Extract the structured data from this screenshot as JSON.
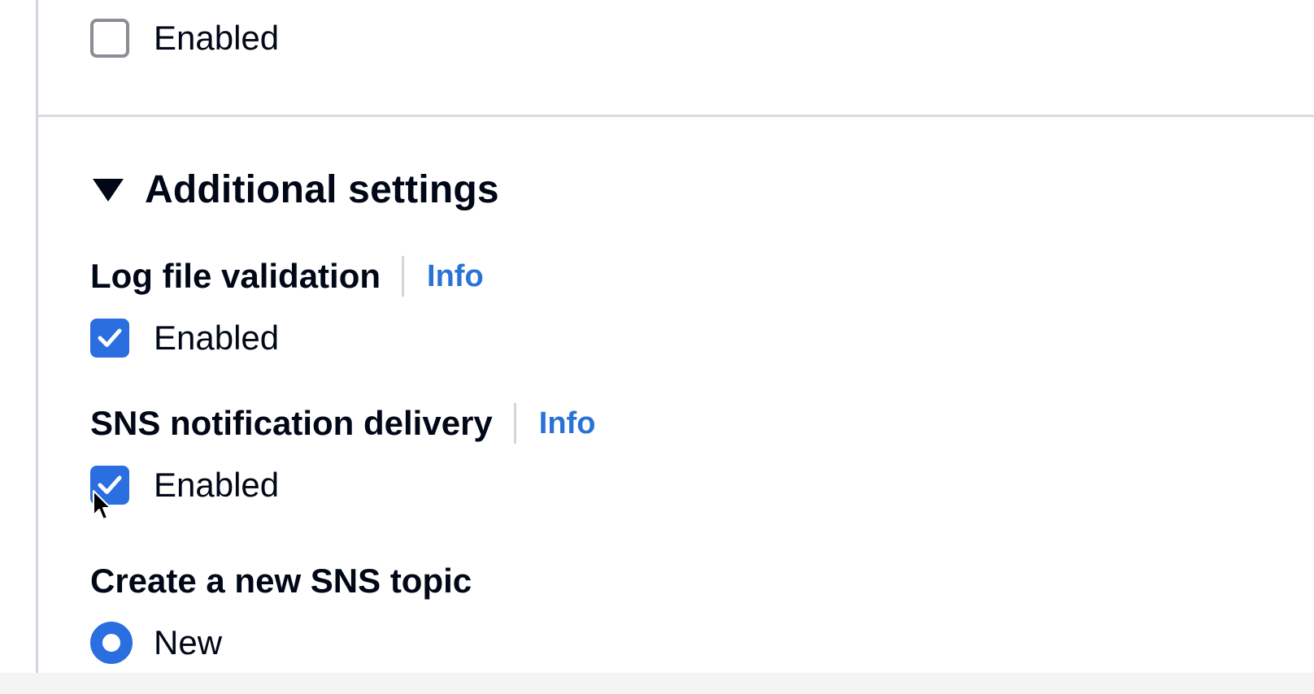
{
  "top_option": {
    "label": "Enabled",
    "checked": false
  },
  "additional_settings": {
    "title": "Additional settings",
    "expanded": true,
    "log_file_validation": {
      "label": "Log file validation",
      "info_label": "Info",
      "option_label": "Enabled",
      "checked": true
    },
    "sns_notification_delivery": {
      "label": "SNS notification delivery",
      "info_label": "Info",
      "option_label": "Enabled",
      "checked": true
    },
    "create_sns_topic": {
      "label": "Create a new SNS topic",
      "selected_option_label": "New"
    }
  },
  "icons": {
    "caret": "caret-down-icon",
    "checkmark": "checkmark-icon",
    "cursor": "mouse-pointer-icon"
  },
  "colors": {
    "accent": "#2a6ee0",
    "link": "#2a73d6",
    "text": "#000716",
    "border": "#8c8c94"
  }
}
